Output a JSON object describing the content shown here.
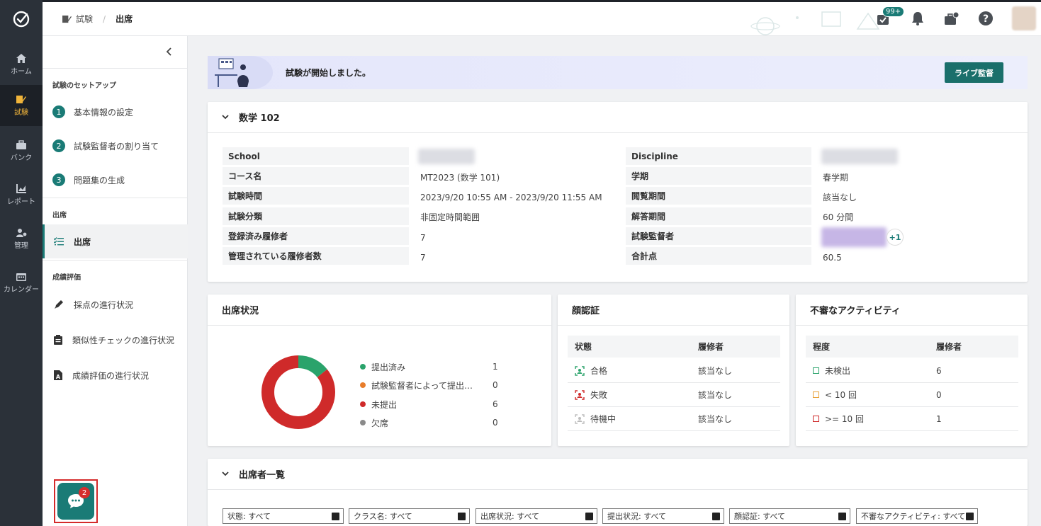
{
  "nav_rail": {
    "items": [
      {
        "label": "ホーム",
        "icon": "home-icon"
      },
      {
        "label": "試験",
        "icon": "exam-icon"
      },
      {
        "label": "バンク",
        "icon": "bank-icon"
      },
      {
        "label": "レポート",
        "icon": "report-icon"
      },
      {
        "label": "管理",
        "icon": "admin-icon"
      },
      {
        "label": "カレンダー",
        "icon": "calendar-icon"
      }
    ]
  },
  "header": {
    "breadcrumb_parent": "試験",
    "breadcrumb_current": "出席",
    "task_badge": "99+"
  },
  "sidebar": {
    "setup_title": "試験のセットアップ",
    "steps": [
      {
        "num": "1",
        "label": "基本情報の設定"
      },
      {
        "num": "2",
        "label": "試験監督者の割り当て"
      },
      {
        "num": "3",
        "label": "問題集の生成"
      }
    ],
    "attendance_title": "出席",
    "attendance_item": "出席",
    "grading_title": "成績評価",
    "grading_items": [
      "採点の進行状況",
      "類似性チェックの進行状況",
      "成績評価の進行状況"
    ],
    "chat_badge": "2"
  },
  "banner": {
    "message": "試験が開始しました。",
    "live_button": "ライブ監督"
  },
  "exam_info": {
    "title": "数学 102",
    "left": [
      {
        "label": "School",
        "value": ""
      },
      {
        "label": "コース名",
        "value": "MT2023 (数学 101)"
      },
      {
        "label": "試験時間",
        "value": "2023/9/20 10:55 AM - 2023/9/20 11:55 AM"
      },
      {
        "label": "試験分類",
        "value": "非固定時間範囲"
      },
      {
        "label": "登録済み履修者",
        "value": "7"
      },
      {
        "label": "管理されている履修者数",
        "value": "7"
      }
    ],
    "right": [
      {
        "label": "Discipline",
        "value": ""
      },
      {
        "label": "学期",
        "value": "春学期"
      },
      {
        "label": "閲覧期間",
        "value": "該当なし"
      },
      {
        "label": "解答期間",
        "value": "60 分間"
      },
      {
        "label": "試験監督者",
        "value": "",
        "extra": "+1"
      },
      {
        "label": "合計点",
        "value": "60.5"
      }
    ]
  },
  "attendance": {
    "title": "出席状況",
    "legend": [
      {
        "label": "提出済み",
        "count": "1",
        "color": "#2aa36b"
      },
      {
        "label": "試験監督者によって提出…",
        "count": "0",
        "color": "#e87d2b"
      },
      {
        "label": "未提出",
        "count": "6",
        "color": "#cf2a2a"
      },
      {
        "label": "欠席",
        "count": "0",
        "color": "#8a8a8a"
      }
    ]
  },
  "chart_data": {
    "type": "pie",
    "categories": [
      "提出済み",
      "試験監督者によって提出…",
      "未提出",
      "欠席"
    ],
    "values": [
      1,
      0,
      6,
      0
    ],
    "colors": [
      "#2aa36b",
      "#e87d2b",
      "#cf2a2a",
      "#8a8a8a"
    ]
  },
  "face_auth": {
    "title": "顔認証",
    "col_status": "状態",
    "col_students": "履修者",
    "rows": [
      {
        "status": "合格",
        "count": "該当なし",
        "color": "#2aa36b"
      },
      {
        "status": "失敗",
        "count": "該当なし",
        "color": "#cf2a2a"
      },
      {
        "status": "待機中",
        "count": "該当なし",
        "color": "#bdbdbd"
      }
    ]
  },
  "suspicious": {
    "title": "不審なアクティビティ",
    "col_level": "程度",
    "col_students": "履修者",
    "rows": [
      {
        "level": "未検出",
        "count": "6",
        "color": "#2aa36b"
      },
      {
        "level": "< 10 回",
        "count": "0",
        "color": "#e8a23a"
      },
      {
        "level": ">= 10 回",
        "count": "1",
        "color": "#cf2a2a"
      }
    ]
  },
  "attendee_list": {
    "title": "出席者一覧",
    "filters": [
      "状態: すべて",
      "クラス名: すべて",
      "出席状況: すべて",
      "提出状況: すべて",
      "顔認証: すべて",
      "不審なアクティビティ: すべて"
    ]
  }
}
